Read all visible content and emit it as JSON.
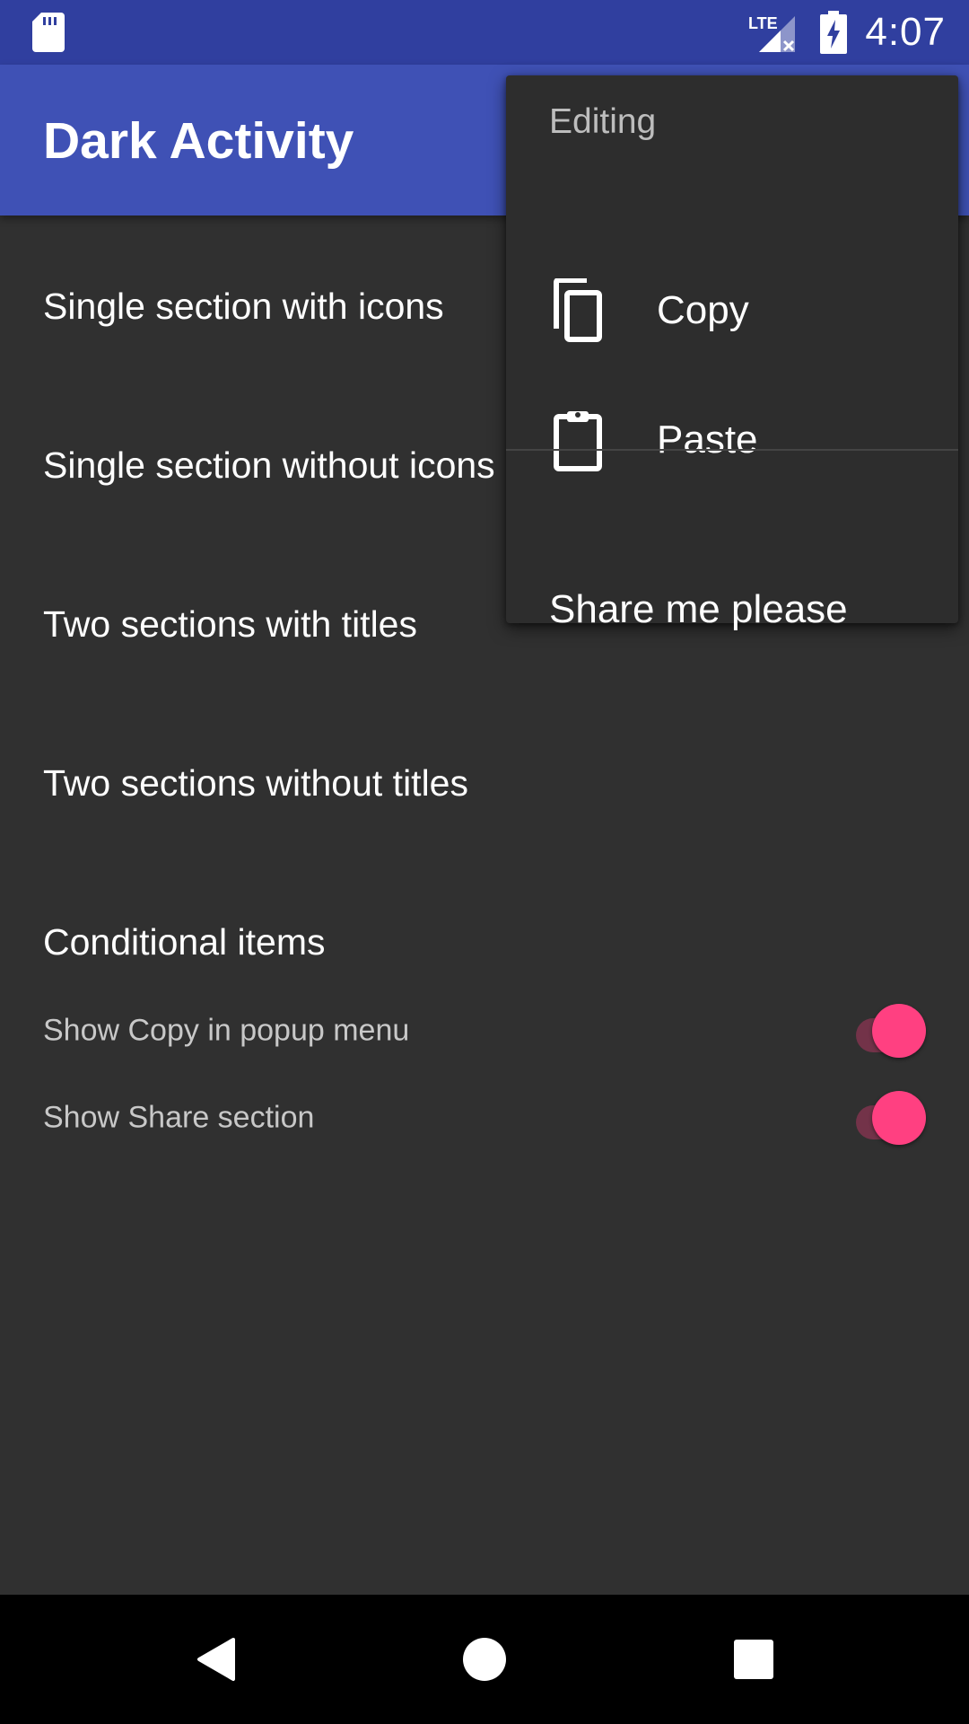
{
  "status_bar": {
    "time": "4:07",
    "network": "LTE",
    "icons": [
      "sd-card-icon",
      "lte-signal-icon",
      "battery-charging-icon"
    ]
  },
  "app_bar": {
    "title": "Dark Activity"
  },
  "list": {
    "items": [
      {
        "label": "Single section with icons"
      },
      {
        "label": "Single section without icons"
      },
      {
        "label": "Two sections with titles"
      },
      {
        "label": "Two sections without titles"
      }
    ],
    "conditional_header": "Conditional items",
    "settings": [
      {
        "label": "Show Copy in popup menu",
        "checked": true
      },
      {
        "label": "Show Share section",
        "checked": true
      }
    ]
  },
  "popup": {
    "section_title": "Editing",
    "items": [
      {
        "label": "Copy",
        "icon": "copy-icon"
      },
      {
        "label": "Paste",
        "icon": "clipboard-icon"
      }
    ],
    "share_label": "Share me please"
  },
  "nav_bar": {
    "icons": [
      "back-icon",
      "home-icon",
      "recents-icon"
    ]
  },
  "colors": {
    "status_bar": "#303f9f",
    "app_bar": "#3f51b5",
    "background": "#303030",
    "popup": "#2d2d2d",
    "accent": "#ff4081"
  }
}
